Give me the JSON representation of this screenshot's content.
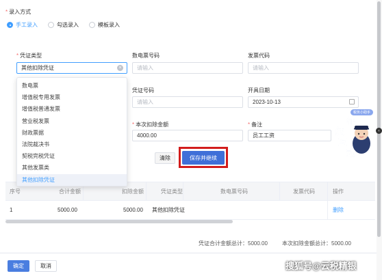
{
  "entry_mode": {
    "label": "录入方式",
    "options": [
      {
        "label": "手工录入",
        "selected": true
      },
      {
        "label": "勾选录入",
        "selected": false
      },
      {
        "label": "模板录入",
        "selected": false
      }
    ]
  },
  "form": {
    "voucher_type": {
      "label": "凭证类型",
      "value": "其他扣除凭证"
    },
    "e_ticket_no": {
      "label": "数电票号码",
      "placeholder": "请输入"
    },
    "invoice_code": {
      "label": "发票代码",
      "placeholder": "请输入"
    },
    "voucher_no": {
      "label": "凭证号码",
      "placeholder": "请输入"
    },
    "issue_date": {
      "label": "开具日期",
      "value": "2023-10-13"
    },
    "deduct_amount": {
      "label": "本次扣除金额",
      "value": "4000.00"
    },
    "remark": {
      "label": "备注",
      "value": "员工工资"
    }
  },
  "dropdown": {
    "items": [
      "数电票",
      "增值税专用发票",
      "增值税普通发票",
      "营业税发票",
      "财政票据",
      "法院裁决书",
      "契税完税凭证",
      "其他发票类",
      "其他扣除凭证"
    ],
    "selected_index": 8
  },
  "buttons": {
    "clear": "清除",
    "save_continue": "保存并继续",
    "ok": "确定",
    "cancel": "取消"
  },
  "table": {
    "headers": [
      "序号",
      "合计金额",
      "扣除金额",
      "凭证类型",
      "数电票号码",
      "发票代码",
      "操作"
    ],
    "rows": [
      {
        "no": "1",
        "total": "5000.00",
        "deduct": "5000.00",
        "type": "其他扣除凭证",
        "e_no": "",
        "code": "",
        "action": "删除"
      }
    ]
  },
  "summary": {
    "voucher_total": "凭证合计金额总计：5000.00",
    "deduct_total": "本次扣除金额总计：5000.00"
  },
  "mascot": {
    "badge": "税务小助手",
    "chars": [
      "征",
      "纳",
      "互",
      "动"
    ]
  },
  "watermark": "搜狐号@云税精银",
  "colors": {
    "primary": "#409eff",
    "save_button": "#3f6fd8",
    "highlight_border": "#d21c1c",
    "required": "#f56c6c"
  }
}
